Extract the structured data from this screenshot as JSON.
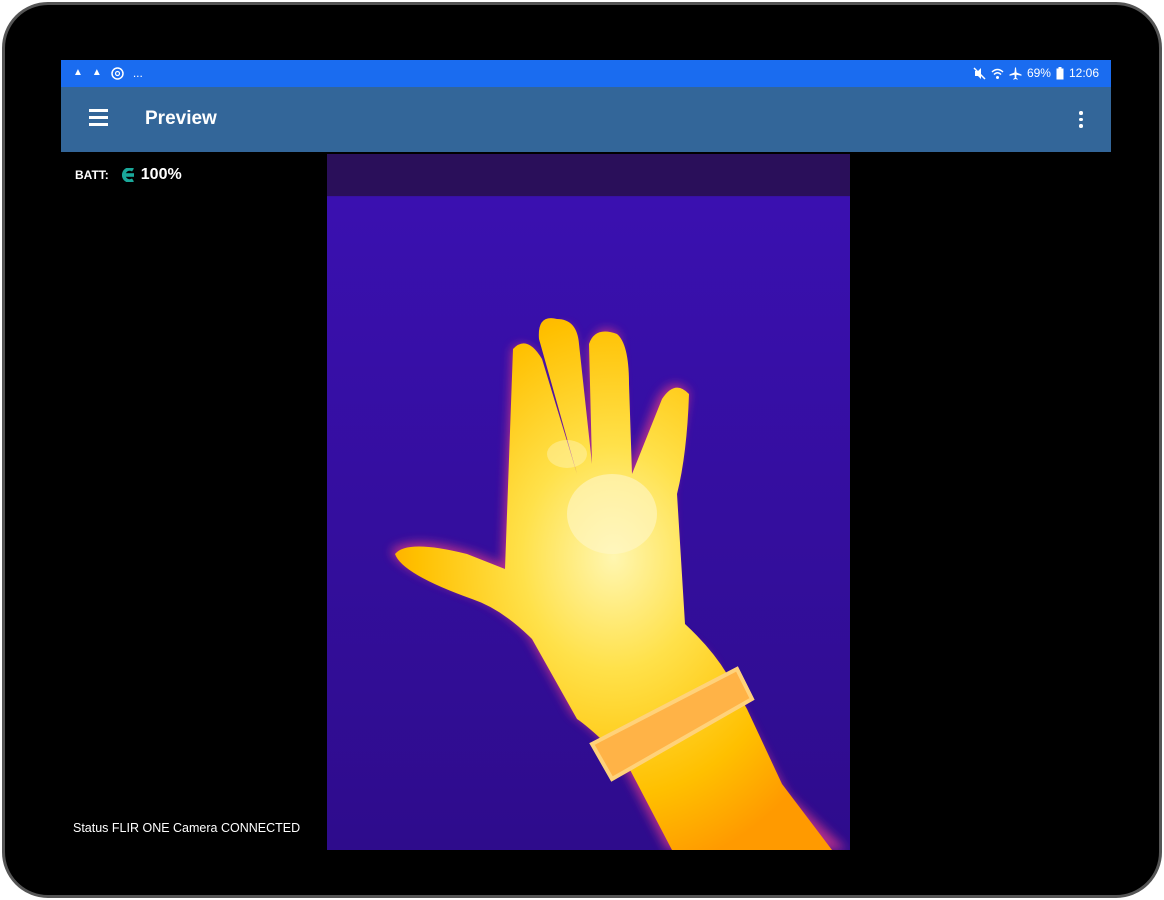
{
  "statusbar": {
    "left_icons": [
      "notification-icon",
      "notification-icon",
      "sync-icon"
    ],
    "more": "...",
    "battery_percent": "69%",
    "time": "12:06",
    "right_icons": [
      "mute-icon",
      "wifi-icon",
      "airplane-icon",
      "battery-icon"
    ]
  },
  "appbar": {
    "title": "Preview",
    "color": "#336699"
  },
  "battery": {
    "label": "BATT:",
    "value": "100%",
    "icon_color": "#1aa89a"
  },
  "status": {
    "text": "Status FLIR ONE Camera CONNECTED"
  },
  "colors": {
    "statusbar": "#1a6cf0",
    "thermal_background": "#2a0a9a",
    "thermal_hot": "#ffd700"
  }
}
